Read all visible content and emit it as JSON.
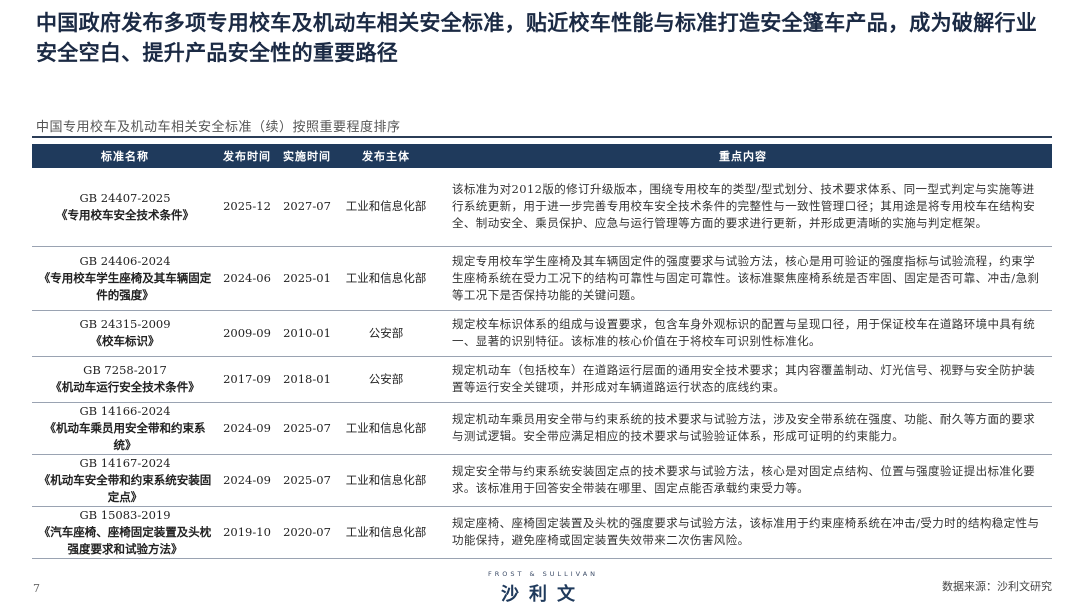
{
  "header": {
    "title": "中国政府发布多项专用校车及机动车相关安全标准，贴近校车性能与标准打造安全篷车产品，成为破解行业安全空白、提升产品安全性的重要路径",
    "subtitle": "中国专用校车及机动车相关安全标准（续）按照重要程度排序"
  },
  "table": {
    "columns": [
      "标准名称",
      "发布时间",
      "实施时间",
      "发布主体",
      "重点内容"
    ],
    "rows": [
      {
        "code": "GB 24407-2025",
        "name": "《专用校车安全技术条件》",
        "published": "2025-12",
        "effective": "2027-07",
        "issuer": "工业和信息化部",
        "content": "该标准为对2012版的修订升级版本，围绕专用校车的类型/型式划分、技术要求体系、同一型式判定与实施等进行系统更新，用于进一步完善专用校车安全技术条件的完整性与一致性管理口径；其用途是将专用校车在结构安全、制动安全、乘员保护、应急与运行管理等方面的要求进行更新，并形成更清晰的实施与判定框架。"
      },
      {
        "code": "GB 24406-2024",
        "name": "《专用校车学生座椅及其车辆固定件的强度》",
        "published": "2024-06",
        "effective": "2025-01",
        "issuer": "工业和信息化部",
        "content": "规定专用校车学生座椅及其车辆固定件的强度要求与试验方法，核心是用可验证的强度指标与试验流程，约束学生座椅系统在受力工况下的结构可靠性与固定可靠性。该标准聚焦座椅系统是否牢固、固定是否可靠、冲击/急刹等工况下是否保持功能的关键问题。"
      },
      {
        "code": "GB 24315-2009",
        "name": "《校车标识》",
        "published": "2009-09",
        "effective": "2010-01",
        "issuer": "公安部",
        "content": "规定校车标识体系的组成与设置要求，包含车身外观标识的配置与呈现口径，用于保证校车在道路环境中具有统一、显著的识别特征。该标准的核心价值在于将校车可识别性标准化。"
      },
      {
        "code": "GB 7258-2017",
        "name": "《机动车运行安全技术条件》",
        "published": "2017-09",
        "effective": "2018-01",
        "issuer": "公安部",
        "content": "规定机动车（包括校车）在道路运行层面的通用安全技术要求；其内容覆盖制动、灯光信号、视野与安全防护装置等运行安全关键项，并形成对车辆道路运行状态的底线约束。"
      },
      {
        "code": "GB 14166-2024",
        "name": "《机动车乘员用安全带和约束系统》",
        "published": "2024-09",
        "effective": "2025-07",
        "issuer": "工业和信息化部",
        "content": "规定机动车乘员用安全带与约束系统的技术要求与试验方法，涉及安全带系统在强度、功能、耐久等方面的要求与测试逻辑。安全带应满足相应的技术要求与试验验证体系，形成可证明的约束能力。"
      },
      {
        "code": "GB 14167-2024",
        "name": "《机动车安全带和约束系统安装固定点》",
        "published": "2024-09",
        "effective": "2025-07",
        "issuer": "工业和信息化部",
        "content": "规定安全带与约束系统安装固定点的技术要求与试验方法，核心是对固定点结构、位置与强度验证提出标准化要求。该标准用于回答安全带装在哪里、固定点能否承载约束受力等。"
      },
      {
        "code": "GB 15083-2019",
        "name": "《汽车座椅、座椅固定装置及头枕强度要求和试验方法》",
        "published": "2019-10",
        "effective": "2020-07",
        "issuer": "工业和信息化部",
        "content": "规定座椅、座椅固定装置及头枕的强度要求与试验方法，该标准用于约束座椅系统在冲击/受力时的结构稳定性与功能保持，避免座椅或固定装置失效带来二次伤害风险。"
      }
    ]
  },
  "footer": {
    "page_number": "7",
    "logo_en": "FROST & SULLIVAN",
    "logo_cn": "沙利文",
    "source": "数据来源：沙利文研究"
  }
}
